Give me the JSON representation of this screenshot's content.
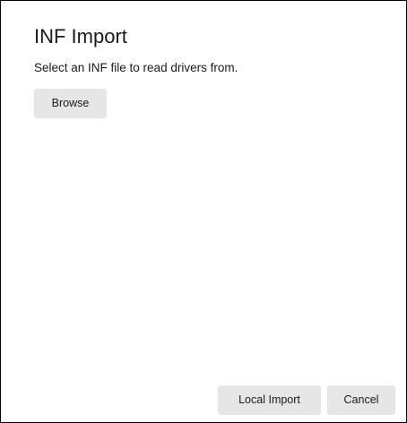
{
  "dialog": {
    "title": "INF Import",
    "description": "Select an INF file to read drivers from.",
    "browse_label": "Browse",
    "local_import_label": "Local Import",
    "cancel_label": "Cancel"
  },
  "colors": {
    "background": "#ffffff",
    "border": "#000000",
    "text": "#1a1a1a",
    "button_background": "#e6e6e6"
  }
}
